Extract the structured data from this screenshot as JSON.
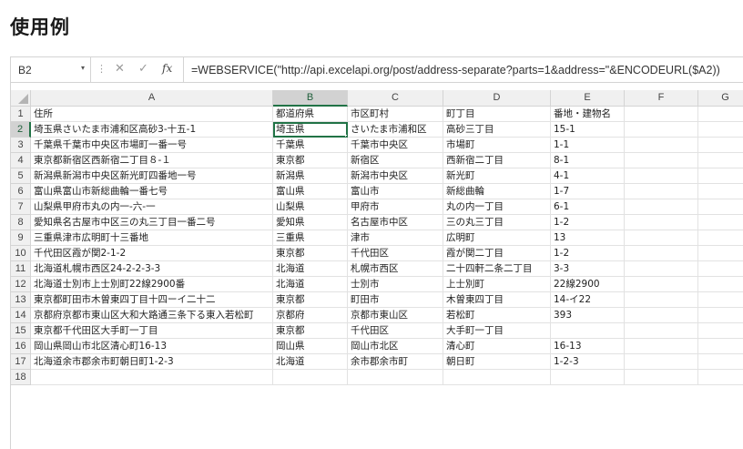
{
  "page": {
    "title": "使用例"
  },
  "formula_bar": {
    "name_box": "B2",
    "dropdown_glyph": "▾",
    "dots_glyph": "⋮",
    "cancel_glyph": "✕",
    "enter_glyph": "✓",
    "fx_glyph": "fx",
    "formula": "=WEBSERVICE(\"http://api.excelapi.org/post/address-separate?parts=1&address=\"&ENCODEURL($A2))"
  },
  "sheet": {
    "active_cell": "B2",
    "columns": [
      "A",
      "B",
      "C",
      "D",
      "E",
      "F",
      "G"
    ],
    "rows": [
      {
        "num": "1",
        "cells": [
          "住所",
          "都道府県",
          "市区町村",
          "町丁目",
          "番地・建物名"
        ]
      },
      {
        "num": "2",
        "cells": [
          "埼玉県さいたま市浦和区高砂3-十五-1",
          "埼玉県",
          "さいたま市浦和区",
          "高砂三丁目",
          "15-1"
        ]
      },
      {
        "num": "3",
        "cells": [
          "千葉県千葉市中央区市場町一番一号",
          "千葉県",
          "千葉市中央区",
          "市場町",
          "1-1"
        ]
      },
      {
        "num": "4",
        "cells": [
          "東京都新宿区西新宿二丁目８-１",
          "東京都",
          "新宿区",
          "西新宿二丁目",
          "8-1"
        ]
      },
      {
        "num": "5",
        "cells": [
          "新潟県新潟市中央区新光町四番地一号",
          "新潟県",
          "新潟市中央区",
          "新光町",
          "4-1"
        ]
      },
      {
        "num": "6",
        "cells": [
          "富山県富山市新総曲輪一番七号",
          "富山県",
          "富山市",
          "新総曲輪",
          "1-7"
        ]
      },
      {
        "num": "7",
        "cells": [
          "山梨県甲府市丸の内一-六-一",
          "山梨県",
          "甲府市",
          "丸の内一丁目",
          "6-1"
        ]
      },
      {
        "num": "8",
        "cells": [
          "愛知県名古屋市中区三の丸三丁目一番二号",
          "愛知県",
          "名古屋市中区",
          "三の丸三丁目",
          "1-2"
        ]
      },
      {
        "num": "9",
        "cells": [
          "三重県津市広明町十三番地",
          "三重県",
          "津市",
          "広明町",
          "13"
        ]
      },
      {
        "num": "10",
        "cells": [
          "千代田区霞が関2-1-2",
          "東京都",
          "千代田区",
          "霞が関二丁目",
          "1-2"
        ]
      },
      {
        "num": "11",
        "cells": [
          "北海道札幌市西区24-2-2-3-3",
          "北海道",
          "札幌市西区",
          "二十四軒二条二丁目",
          "3-3"
        ]
      },
      {
        "num": "12",
        "cells": [
          "北海道士別市上士別町22線2900番",
          "北海道",
          "士別市",
          "上士別町",
          "22線2900"
        ]
      },
      {
        "num": "13",
        "cells": [
          "東京都町田市木曽東四丁目十四ーイ二十二",
          "東京都",
          "町田市",
          "木曽東四丁目",
          "14-イ22"
        ]
      },
      {
        "num": "14",
        "cells": [
          "京都府京都市東山区大和大路通三条下る東入若松町",
          "京都府",
          "京都市東山区",
          "若松町",
          "393"
        ]
      },
      {
        "num": "15",
        "cells": [
          "東京都千代田区大手町一丁目",
          "東京都",
          "千代田区",
          "大手町一丁目",
          ""
        ]
      },
      {
        "num": "16",
        "cells": [
          "岡山県岡山市北区清心町16-13",
          "岡山県",
          "岡山市北区",
          "清心町",
          "16-13"
        ]
      },
      {
        "num": "17",
        "cells": [
          "北海道余市郡余市町朝日町1-2-3",
          "北海道",
          "余市郡余市町",
          "朝日町",
          "1-2-3"
        ]
      },
      {
        "num": "18",
        "cells": [
          "",
          "",
          "",
          "",
          ""
        ]
      }
    ]
  }
}
